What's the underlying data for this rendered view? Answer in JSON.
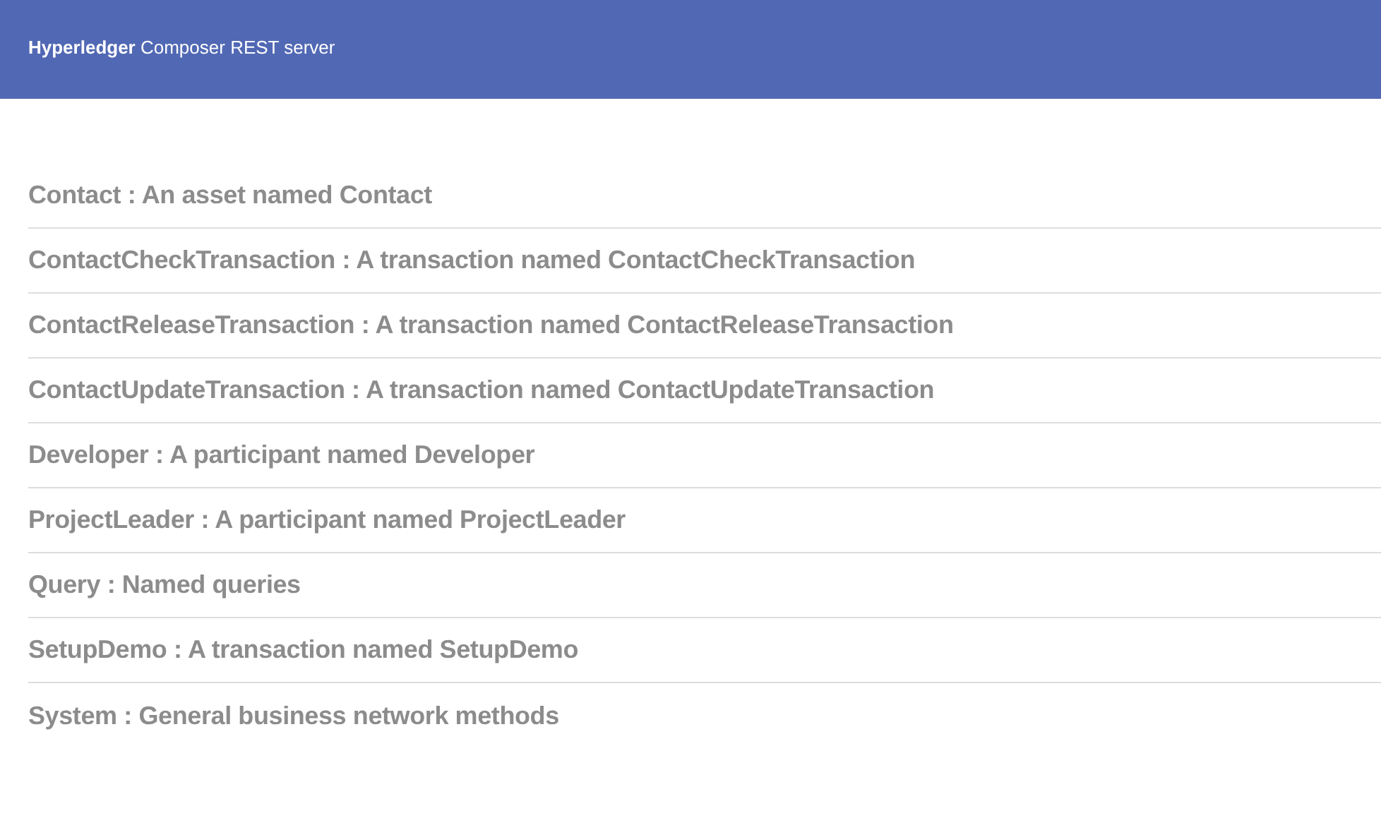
{
  "header": {
    "title": "**Hyperledger** Composer REST server"
  },
  "resources": [
    {
      "label": "Contact : An asset named Contact"
    },
    {
      "label": "ContactCheckTransaction : A transaction named ContactCheckTransaction"
    },
    {
      "label": "ContactReleaseTransaction : A transaction named ContactReleaseTransaction"
    },
    {
      "label": "ContactUpdateTransaction : A transaction named ContactUpdateTransaction"
    },
    {
      "label": "Developer : A participant named Developer"
    },
    {
      "label": "ProjectLeader : A participant named ProjectLeader"
    },
    {
      "label": "Query : Named queries"
    },
    {
      "label": "SetupDemo : A transaction named SetupDemo"
    },
    {
      "label": "System : General business network methods"
    }
  ]
}
